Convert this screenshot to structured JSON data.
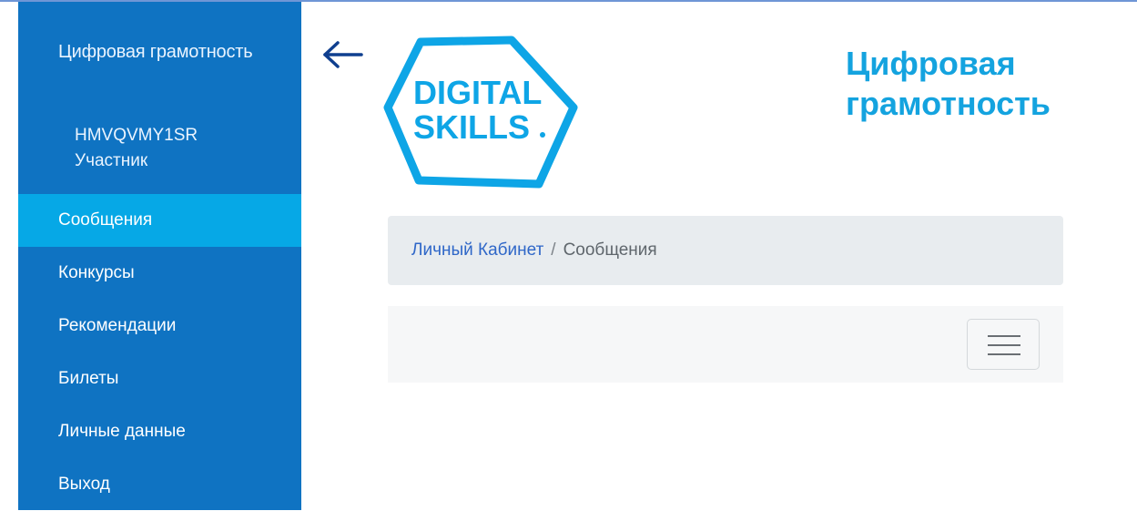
{
  "sidebar": {
    "app_title": "Цифровая грамотность",
    "user_code": "HMVQVMY1SR",
    "user_role": "Участник",
    "menu": [
      {
        "label": "Сообщения",
        "active": true
      },
      {
        "label": "Конкурсы",
        "active": false
      },
      {
        "label": "Рекомендации",
        "active": false
      },
      {
        "label": "Билеты",
        "active": false
      },
      {
        "label": "Личные данные",
        "active": false
      },
      {
        "label": "Выход",
        "active": false
      }
    ]
  },
  "header": {
    "back_icon": "arrow-left-icon",
    "logo_line1": "DIGITAL",
    "logo_line2": "SKILLS",
    "brand_line1": "Цифровая",
    "brand_line2": "грамотность"
  },
  "breadcrumb": {
    "home": "Личный Кабинет",
    "separator": "/",
    "current": "Сообщения"
  },
  "navbar": {
    "toggler_icon": "hamburger-menu-icon"
  },
  "colors": {
    "sidebar_bg": "#0f73c2",
    "sidebar_active": "#06a8e6",
    "brand": "#14a3df",
    "link": "#2f67c8"
  }
}
